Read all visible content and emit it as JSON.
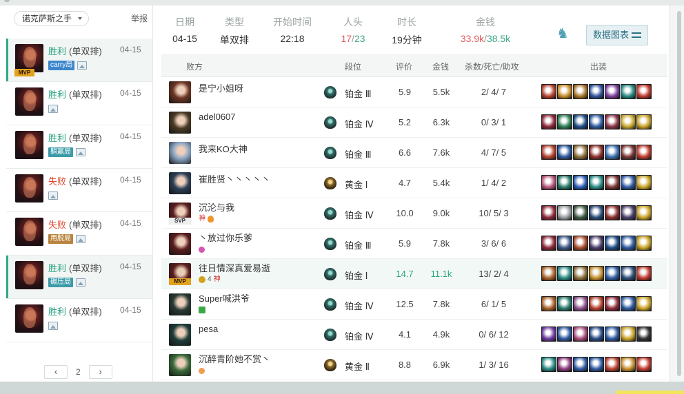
{
  "sidebar": {
    "champion_select": "诺克萨斯之手",
    "report_label": "举报",
    "matches": [
      {
        "result": "胜利",
        "outcome": "win",
        "type": "(单双排)",
        "date": "04-15",
        "mvp": "MVP",
        "tag": "carry局",
        "tag_color": "#3d86cc",
        "active": true
      },
      {
        "result": "胜利",
        "outcome": "win",
        "type": "(单双排)",
        "date": "04-15",
        "mvp": "",
        "tag": "",
        "tag_color": "",
        "active": false
      },
      {
        "result": "胜利",
        "outcome": "win",
        "type": "(单双排)",
        "date": "04-15",
        "mvp": "",
        "tag": "躺赢局",
        "tag_color": "#3c9ba9",
        "active": false
      },
      {
        "result": "失败",
        "outcome": "loss",
        "type": "(单双排)",
        "date": "04-15",
        "mvp": "",
        "tag": "",
        "tag_color": "",
        "active": false
      },
      {
        "result": "失败",
        "outcome": "loss",
        "type": "(单双排)",
        "date": "04-15",
        "mvp": "",
        "tag": "用脱局",
        "tag_color": "#b8833d",
        "active": false
      },
      {
        "result": "胜利",
        "outcome": "win",
        "type": "(单双排)",
        "date": "04-15",
        "mvp": "",
        "tag": "碾压局",
        "tag_color": "#3c9ba9",
        "active": true
      },
      {
        "result": "胜利",
        "outcome": "win",
        "type": "(单双排)",
        "date": "04-15",
        "mvp": "",
        "tag": "",
        "tag_color": "",
        "active": false
      }
    ],
    "pager": {
      "prev": "‹",
      "page": "2",
      "next": "›"
    }
  },
  "summary": {
    "date": {
      "label": "日期",
      "value": "04-15"
    },
    "type": {
      "label": "类型",
      "value": "单双排"
    },
    "start": {
      "label": "开始时间",
      "value": "22:18"
    },
    "kills": {
      "label": "人头",
      "v1": "17",
      "sep": "/",
      "v2": "23"
    },
    "duration": {
      "label": "时长",
      "value": "19分钟"
    },
    "gold": {
      "label": "金钱",
      "v1": "33.9k",
      "sep": "/",
      "v2": "38.5k"
    },
    "team_icon": "dragon-icon",
    "chart_button": "数据图表"
  },
  "table": {
    "headers": {
      "team": "败方",
      "rank": "段位",
      "score": "评价",
      "gold": "金钱",
      "kda": "杀数/死亡/助攻",
      "items": "出装"
    },
    "rows": [
      {
        "name": "是宁小姐呀",
        "avatar_color": "#6b3523",
        "avatar_tag": "",
        "badges": [],
        "rank_type": "plat",
        "rank": "铂金 Ⅲ",
        "score": "5.9",
        "gold": "5.5k",
        "kda": "2/ 4/ 7",
        "highlight": false,
        "items": [
          "#b4412f",
          "#c68d2a",
          "#a7742a",
          "#33549b",
          "#7c3f9b",
          "#2a8a83",
          "#c03a2e"
        ]
      },
      {
        "name": "adel0607",
        "avatar_color": "#4a3a24",
        "avatar_tag": "",
        "badges": [],
        "rank_type": "plat",
        "rank": "铂金 Ⅳ",
        "score": "5.2",
        "gold": "6.3k",
        "kda": "0/ 3/ 1",
        "highlight": false,
        "items": [
          "#8d2a3a",
          "#2f7f56",
          "#1f4d86",
          "#2e5aa0",
          "#8b3448",
          "#c9a92e",
          "#caa428"
        ]
      },
      {
        "name": "我来KO大神",
        "avatar_color": "#8aa6c4",
        "avatar_tag": "",
        "badges": [],
        "rank_type": "plat",
        "rank": "铂金 Ⅲ",
        "score": "6.6",
        "gold": "7.6k",
        "kda": "4/ 7/ 5",
        "highlight": false,
        "items": [
          "#b4412f",
          "#2e5aa0",
          "#8a6c38",
          "#8f2f2a",
          "#3a6fb0",
          "#7a3535",
          "#c03a2e"
        ]
      },
      {
        "name": "崔胜贤丶丶丶丶丶",
        "avatar_color": "#2c3e55",
        "avatar_tag": "",
        "badges": [],
        "rank_type": "gold",
        "rank": "黄金 Ⅰ",
        "score": "4.7",
        "gold": "5.4k",
        "kda": "1/ 4/ 2",
        "highlight": false,
        "items": [
          "#b4567a",
          "#2a7a6a",
          "#2a5ab4",
          "#2a8a83",
          "#7a3535",
          "#2e5aa0",
          "#caa428"
        ]
      },
      {
        "name": "沉沦与我",
        "avatar_color": "#5b1d1d",
        "avatar_tag": "SVP",
        "badges": [
          "god",
          "flame"
        ],
        "rank_type": "plat",
        "rank": "铂金 Ⅳ",
        "score": "10.0",
        "gold": "9.0k",
        "kda": "10/ 5/ 3",
        "highlight": false,
        "items": [
          "#8d2a3a",
          "#9a9da0",
          "#3e5a44",
          "#2b4c7a",
          "#8b2f2f",
          "#4a3f6a",
          "#caa428"
        ]
      },
      {
        "name": "丶放过你乐爹",
        "avatar_color": "#5b1d1d",
        "avatar_tag": "",
        "badges": [
          "pink"
        ],
        "rank_type": "plat",
        "rank": "铂金 Ⅲ",
        "score": "5.9",
        "gold": "7.8k",
        "kda": "3/ 6/ 6",
        "highlight": false,
        "items": [
          "#8d2a3a",
          "#3e5a88",
          "#a94c2d",
          "#4a3f6a",
          "#1f4d86",
          "#2e5aa0",
          "#caa428"
        ]
      },
      {
        "name": "往日情深真爱易逝",
        "avatar_color": "#5b1d1d",
        "avatar_tag": "MVP",
        "badges": [
          "gold",
          "num",
          "god"
        ],
        "badge_num": "4",
        "rank_type": "plat",
        "rank": "铂金 Ⅰ",
        "score": "14.7",
        "gold": "11.1k",
        "kda": "13/ 2/ 4",
        "highlight": true,
        "items": [
          "#a8612b",
          "#2a8a83",
          "#8a6c38",
          "#c68d2a",
          "#2e5aa0",
          "#2e4f7a",
          "#c03a2e"
        ]
      },
      {
        "name": "Super喊洪爷",
        "avatar_color": "#2a3a33",
        "avatar_tag": "",
        "badges": [
          "green"
        ],
        "rank_type": "plat",
        "rank": "铂金 Ⅳ",
        "score": "12.5",
        "gold": "7.8k",
        "kda": "6/ 1/ 5",
        "highlight": false,
        "items": [
          "#a8612b",
          "#2a7a6a",
          "#8b4f8c",
          "#b4412f",
          "#8d2a3a",
          "#2e5aa0",
          "#caa428"
        ]
      },
      {
        "name": "pesa",
        "avatar_color": "#1e3d3a",
        "avatar_tag": "",
        "badges": [],
        "rank_type": "plat",
        "rank": "铂金 Ⅳ",
        "score": "4.1",
        "gold": "4.9k",
        "kda": "0/ 6/ 12",
        "highlight": false,
        "items": [
          "#6b3aa0",
          "#2e5aa0",
          "#a84a7a",
          "#2a4c88",
          "#2e5aa0",
          "#caa428",
          "#333"
        ]
      },
      {
        "name": "沉醉青阶她不赏丶",
        "avatar_color": "#3a6a3a",
        "avatar_tag": "",
        "badges": [
          "orange"
        ],
        "rank_type": "gold",
        "rank": "黄金 Ⅱ",
        "score": "8.8",
        "gold": "6.9k",
        "kda": "1/ 3/ 16",
        "highlight": false,
        "items": [
          "#2a8a83",
          "#8b3a7c",
          "#2e5aa0",
          "#2e5aa0",
          "#b4412f",
          "#c68d2a",
          "#c03a2e"
        ]
      }
    ]
  }
}
